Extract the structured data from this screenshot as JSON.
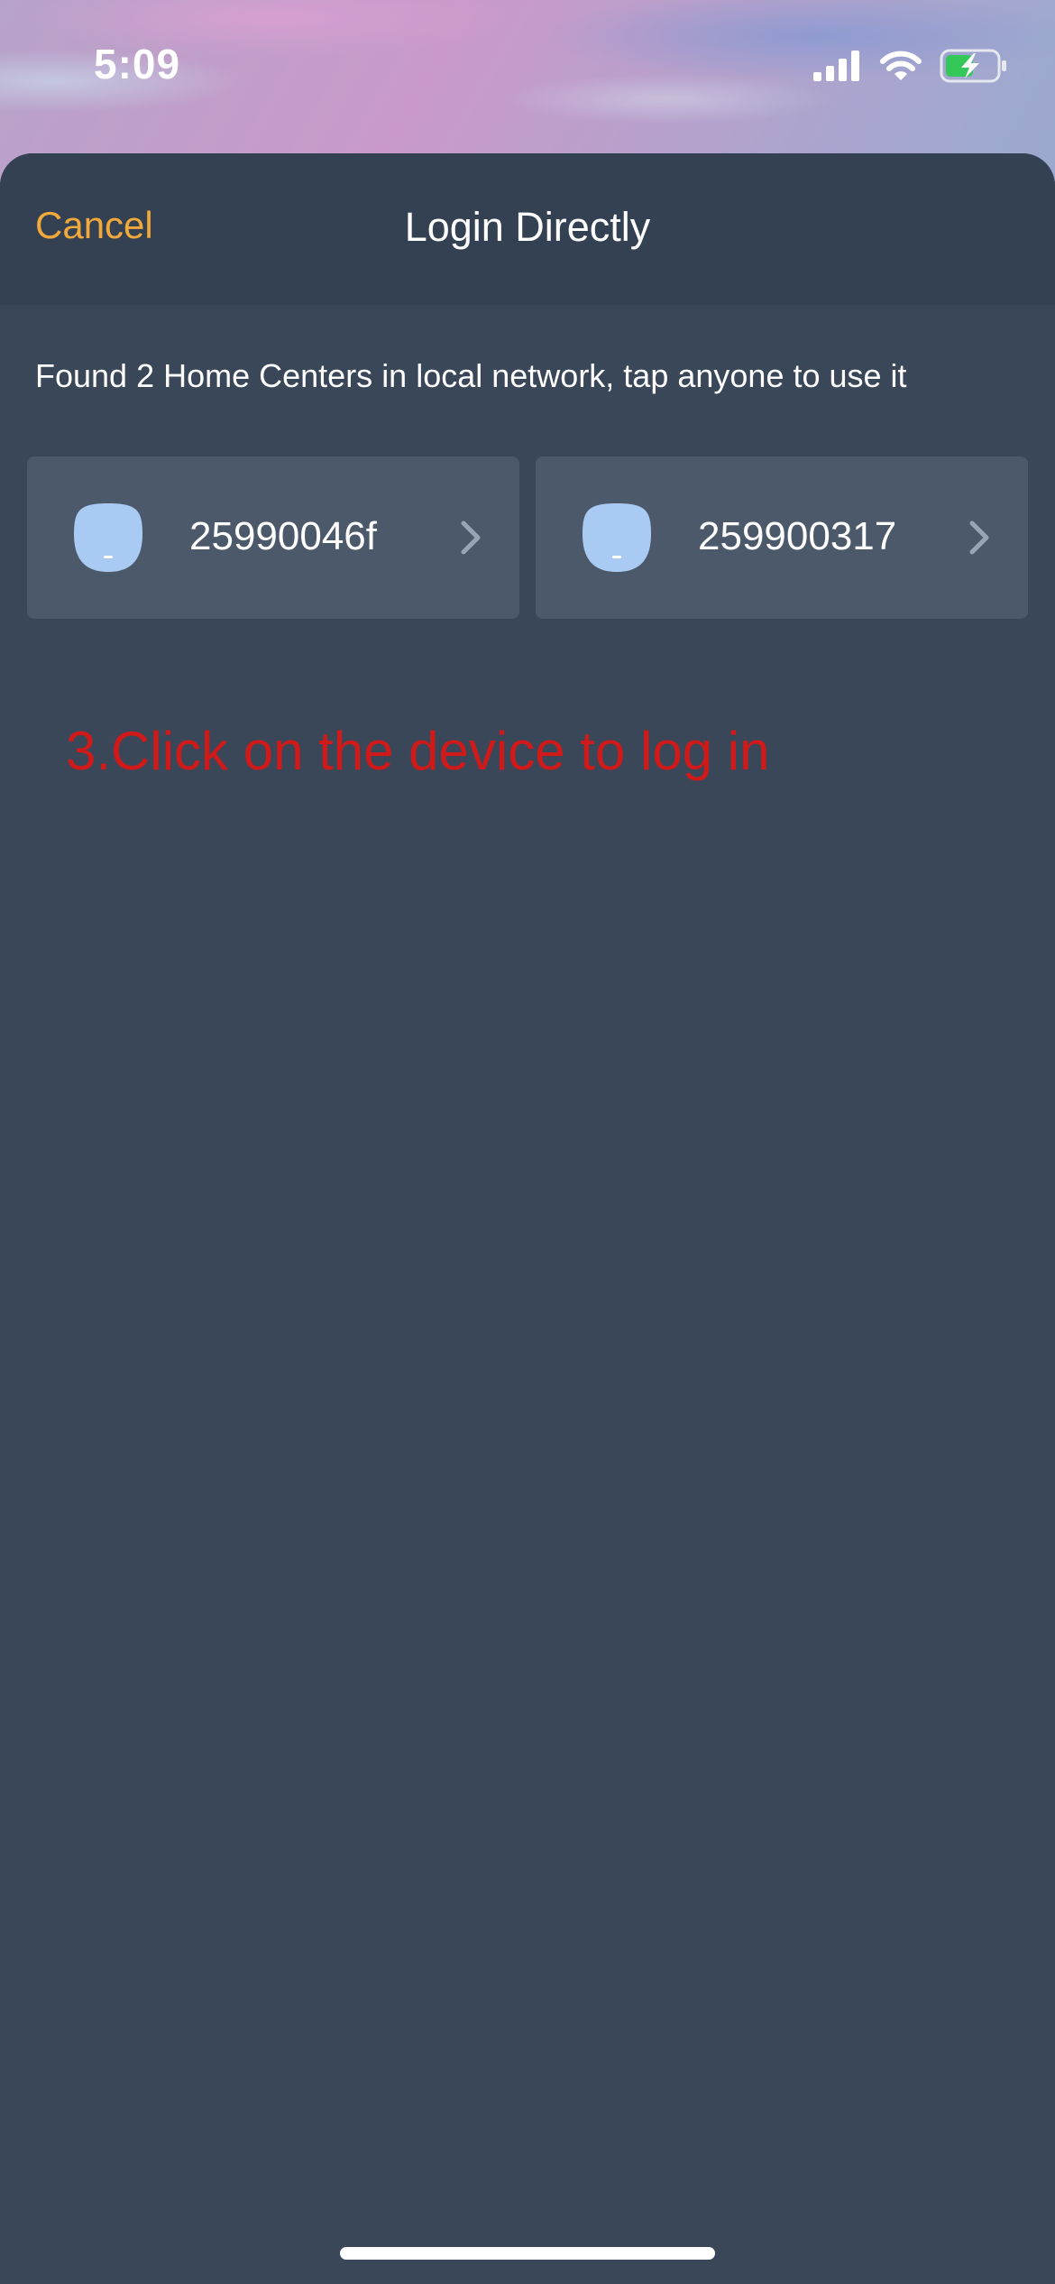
{
  "status_bar": {
    "time": "5:09",
    "icons": [
      "cellular-signal-icon",
      "wifi-icon",
      "battery-charging-icon"
    ]
  },
  "nav": {
    "cancel_label": "Cancel",
    "title": "Login Directly"
  },
  "found_message": "Found 2 Home Centers in local network, tap anyone to use it",
  "devices": [
    {
      "label": "25990046f",
      "icon": "home-center-device-icon"
    },
    {
      "label": "259900317",
      "icon": "home-center-device-icon"
    }
  ],
  "annotation": "3.Click on the device to log in",
  "colors": {
    "accent": "#f2a93b",
    "sheet_background": "#394759",
    "nav_background": "#344152",
    "card_background": "#4c596b",
    "device_icon": "#a9cbf3",
    "annotation_text": "#d01a1a",
    "battery_fill": "#34c759"
  }
}
